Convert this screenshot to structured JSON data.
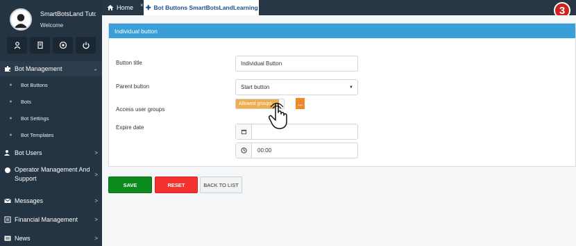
{
  "user": {
    "name": "SmartBotsLand Tutor",
    "greeting": "Welcome"
  },
  "quick_actions": [
    {
      "icon": "user-icon"
    },
    {
      "icon": "document-icon"
    },
    {
      "icon": "help-icon"
    },
    {
      "icon": "power-icon"
    }
  ],
  "sidebar": {
    "bot_management": {
      "label": "Bot Management",
      "arrow": "⌄"
    },
    "sub_items": [
      "Bot Buttons",
      "Bots",
      "Bot Settings",
      "Bot Templates"
    ],
    "bot_users": {
      "label": "Bot Users",
      "arrow": ">"
    },
    "operator": {
      "label": "Operator Management And Support",
      "arrow": ">"
    },
    "messages": {
      "label": "Messages",
      "arrow": ">"
    },
    "financial": {
      "label": "Financial Management",
      "arrow": ">"
    },
    "news": {
      "label": "News",
      "arrow": ">"
    }
  },
  "tabs": {
    "home": "Home",
    "close": "×",
    "active": "Bot Buttons SmartBotsLandLearning"
  },
  "step_badge": "3",
  "form": {
    "header": "Individual button",
    "button_title_label": "Button title",
    "button_title_value": "Individual Button",
    "parent_label": "Parent button",
    "parent_value": "Start button",
    "access_label": "Access user groups",
    "access_tag": "Allowed groups",
    "access_picker": "...",
    "expire_label": "Expire date",
    "expire_date_value": "",
    "expire_time_value": "00:00"
  },
  "actions": {
    "save": "SAVE",
    "reset": "RESET",
    "back": "BACK TO LIST"
  },
  "colors": {
    "sidebar": "#253443",
    "header": "#3a9ed9",
    "save": "#0b8a1e",
    "reset": "#f3312f",
    "tag": "#f0ad4e",
    "badge": "#d0221d"
  }
}
